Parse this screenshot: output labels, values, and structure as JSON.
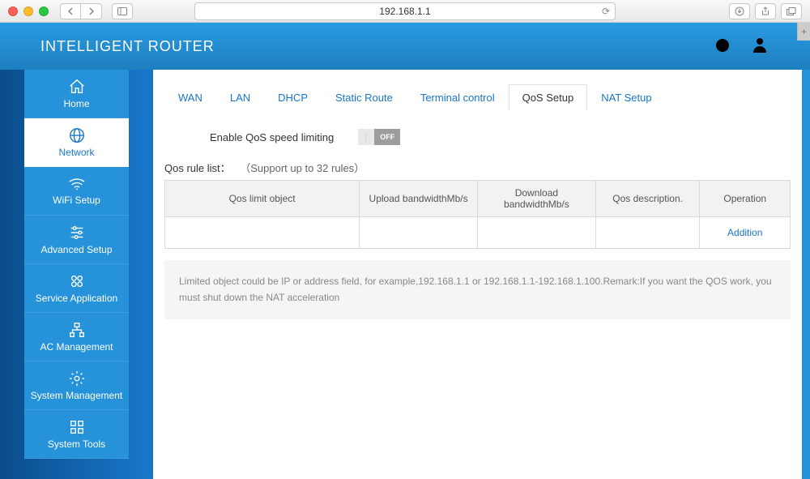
{
  "browser": {
    "url": "192.168.1.1"
  },
  "header": {
    "title": "INTELLIGENT ROUTER"
  },
  "sidebar": {
    "items": [
      {
        "label": "Home"
      },
      {
        "label": "Network"
      },
      {
        "label": "WiFi Setup"
      },
      {
        "label": "Advanced Setup"
      },
      {
        "label": "Service Application"
      },
      {
        "label": "AC Management"
      },
      {
        "label": "System Management"
      },
      {
        "label": "System Tools"
      }
    ]
  },
  "tabs": {
    "items": [
      {
        "label": "WAN"
      },
      {
        "label": "LAN"
      },
      {
        "label": "DHCP"
      },
      {
        "label": "Static Route"
      },
      {
        "label": "Terminal control"
      },
      {
        "label": "QoS Setup"
      },
      {
        "label": "NAT Setup"
      }
    ]
  },
  "form": {
    "enable_label": "Enable QoS speed limiting",
    "toggle_state": "OFF"
  },
  "list": {
    "title": "Qos rule list：",
    "subtitle": "（Support up to 32 rules）",
    "columns": {
      "object": "Qos limit object",
      "upload": "Upload bandwidthMb/s",
      "download": "Download bandwidthMb/s",
      "desc": "Qos description.",
      "op": "Operation"
    },
    "addition_label": "Addition"
  },
  "remark": {
    "text": "Limited object could be IP or address field, for example,192.168.1.1 or 192.168.1.1-192.168.1.100.Remark:If you want the QOS work, you must shut down the NAT acceleration"
  }
}
